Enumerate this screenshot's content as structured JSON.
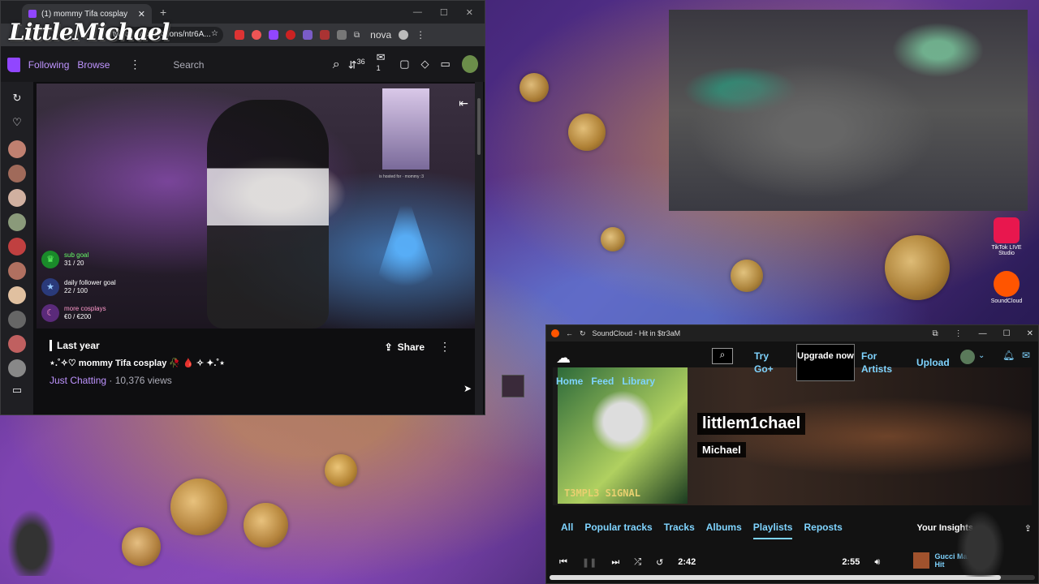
{
  "browser": {
    "tab_title": "(1) mommy Tifa cosplay",
    "url": "twitch.tv/collections/ntr6A...",
    "nova_label": "nova",
    "overlay_logo": "LittleMichael"
  },
  "twitch": {
    "nav": {
      "following": "Following",
      "browse": "Browse",
      "search_placeholder": "Search",
      "notif_count": "36",
      "whisper_count": "1"
    },
    "goals": [
      {
        "name": "sub goal",
        "progress": "31 / 20"
      },
      {
        "name": "daily follower goal",
        "progress": "22 / 100"
      },
      {
        "name": "more cosplays",
        "progress": "€0 / €200"
      }
    ],
    "overlay_banner": "is hosted for · mommy :3",
    "video": {
      "date": "Last year",
      "title": "⋆.˚✧♡ mommy Tifa cosplay 🥀 🩸 ✧ ✦.˚⋆",
      "category": "Just Chatting",
      "views": " · 10,376 views",
      "share_label": "Share"
    }
  },
  "desktop_icons": [
    {
      "label": "TikTok LIVE Studio",
      "color": "#e8174e"
    },
    {
      "label": "SoundCloud",
      "color": "#ff5500"
    }
  ],
  "soundcloud": {
    "window_title": "SoundCloud - Hit in $tr3aM",
    "header": {
      "try_go": "Try Go+",
      "upgrade": "Upgrade now",
      "for_artists": "For Artists",
      "upload": "Upload"
    },
    "top_nav": [
      "Home",
      "Feed",
      "Library"
    ],
    "cover_text": "T3MPL3 S1GNAL",
    "username": "littlem1chael",
    "realname": "Michael",
    "tabs": [
      "All",
      "Popular tracks",
      "Tracks",
      "Albums",
      "Playlists",
      "Reposts"
    ],
    "active_tab": "Playlists",
    "insights": "Your Insights",
    "player": {
      "elapsed": "2:42",
      "duration": "2:55",
      "progress": 0.93
    },
    "track": {
      "artist": "Gucci Ma...",
      "title": "Hit"
    }
  }
}
